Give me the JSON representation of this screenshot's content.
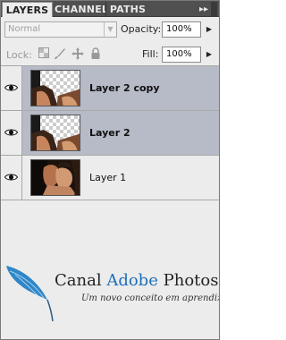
{
  "panel": {
    "tabs": [
      {
        "label": "LAYERS",
        "active": true
      },
      {
        "label": "CHANNEL",
        "active": false
      },
      {
        "label": "PATHS",
        "active": false
      }
    ],
    "menu_glyph": "▸▸",
    "blend_mode": "Normal",
    "opacity_label": "Opacity:",
    "opacity_value": "100%",
    "lock_label": "Lock:",
    "fill_label": "Fill:",
    "fill_value": "100%"
  },
  "layers": [
    {
      "name": "Layer 2 copy",
      "visible": true,
      "selected": true,
      "thumbnail": "transparent-checker-top"
    },
    {
      "name": "Layer 2",
      "visible": true,
      "selected": true,
      "thumbnail": "transparent-checker-top"
    },
    {
      "name": "Layer 1",
      "visible": true,
      "selected": false,
      "thumbnail": "photo-couple"
    }
  ],
  "branding": {
    "brand_part1": "Canal",
    "brand_part2": "Adobe",
    "brand_part3": "Photoshop",
    "tagline": "Um novo conceito em aprendizado",
    "accent_color": "#1f6fb8",
    "feather_color": "#2f86c8"
  },
  "icons": {
    "eye": "eye-icon",
    "lock_transparent": "lock-transparent-icon",
    "lock_image": "brush-icon",
    "lock_position": "move-icon",
    "lock_all": "lock-icon"
  }
}
